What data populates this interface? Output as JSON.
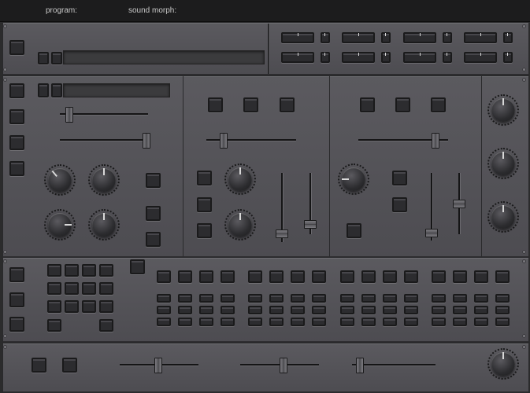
{
  "header": {
    "program_label": "program:",
    "sound_morph_label": "sound morph:"
  }
}
